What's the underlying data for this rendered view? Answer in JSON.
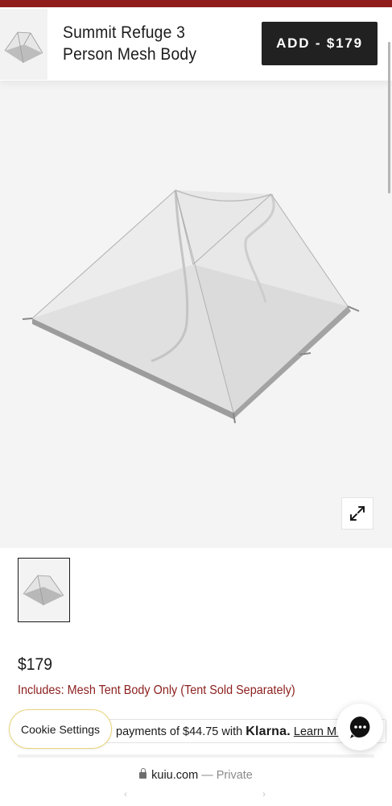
{
  "header": {
    "product_title": "Summit Refuge 3 Person Mesh Body",
    "add_button_label": "ADD - $179"
  },
  "product": {
    "price": "$179",
    "includes": "Includes: Mesh Tent Body Only (Tent Sold Separately)"
  },
  "klarna": {
    "text": "payments of $44.75 with",
    "logo": "Klarna.",
    "learn_more": "Learn More"
  },
  "cookie": {
    "label": "Cookie Settings"
  },
  "browser": {
    "domain": "kuiu.com",
    "separator": "—",
    "mode": "Private",
    "back_glyph": "‹",
    "forward_glyph": "›"
  },
  "icons": [
    "tent-thumbnail-icon",
    "expand-icon",
    "chat-icon",
    "lock-icon"
  ],
  "colors": {
    "brand_red": "#8f1d1b",
    "button_dark": "#212121",
    "includes_text": "#8b1f1d",
    "hero_bg": "#f4f4f4"
  }
}
